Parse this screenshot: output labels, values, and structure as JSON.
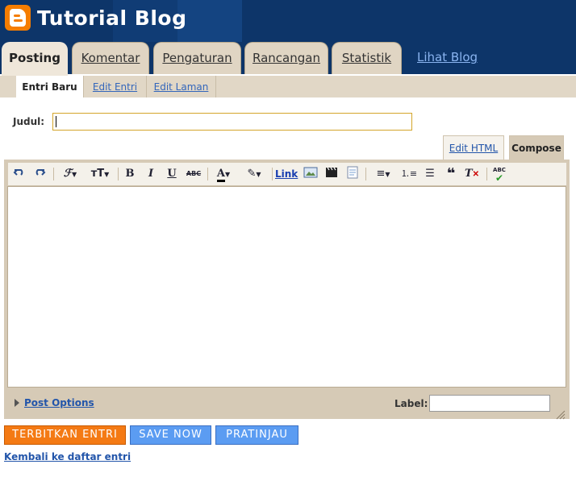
{
  "header": {
    "title": "Tutorial Blog"
  },
  "tabs": [
    {
      "label": "Posting",
      "active": true
    },
    {
      "label": "Komentar"
    },
    {
      "label": "Pengaturan"
    },
    {
      "label": "Rancangan"
    },
    {
      "label": "Statistik"
    }
  ],
  "view_blog_label": "Lihat Blog",
  "subtabs": [
    {
      "label": "Entri Baru",
      "active": true
    },
    {
      "label": "Edit Entri"
    },
    {
      "label": "Edit Laman"
    }
  ],
  "form": {
    "title_label": "Judul:",
    "title_value": "",
    "edit_html_label": "Edit HTML",
    "compose_label": "Compose",
    "post_options_label": "Post Options",
    "label_label": "Label:",
    "label_value": ""
  },
  "toolbar": {
    "link_label": "Link",
    "spellcheck_label": "ABC",
    "strike_label": "ABC"
  },
  "buttons": {
    "publish": "TERBITKAN ENTRI",
    "save": "SAVE NOW",
    "preview": "PRATINJAU"
  },
  "back_link": "Kembali ke daftar entri",
  "colors": {
    "header_bg": "#0d3569",
    "tab_bg": "#e0d5c3",
    "publish_btn": "#f47a14",
    "save_btn": "#5b9cf2",
    "link": "#2255aa"
  }
}
